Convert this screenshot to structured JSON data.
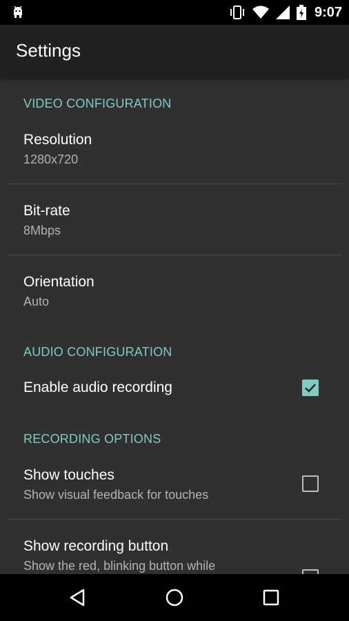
{
  "status_bar": {
    "time": "9:07",
    "icons": [
      "android-debug-icon",
      "vibrate-icon",
      "wifi-icon",
      "cell-signal-icon",
      "battery-charging-icon"
    ]
  },
  "app_bar": {
    "title": "Settings"
  },
  "sections": {
    "video": {
      "header": "VIDEO CONFIGURATION",
      "resolution": {
        "title": "Resolution",
        "summary": "1280x720"
      },
      "bitrate": {
        "title": "Bit-rate",
        "summary": "8Mbps"
      },
      "orientation": {
        "title": "Orientation",
        "summary": "Auto"
      }
    },
    "audio": {
      "header": "AUDIO CONFIGURATION",
      "enable_audio": {
        "title": "Enable audio recording",
        "checked": true
      }
    },
    "recording": {
      "header": "RECORDING OPTIONS",
      "show_touches": {
        "title": "Show touches",
        "summary": "Show visual feedback for touches",
        "checked": false
      },
      "show_recording_button": {
        "title": "Show recording button",
        "summary": "Show the red, blinking button while",
        "checked": false
      }
    }
  },
  "colors": {
    "accent": "#80cbc4",
    "background": "#303030",
    "app_bar": "#212121"
  },
  "nav_bar": {
    "icons": [
      "back-icon",
      "home-icon",
      "recents-icon"
    ]
  }
}
